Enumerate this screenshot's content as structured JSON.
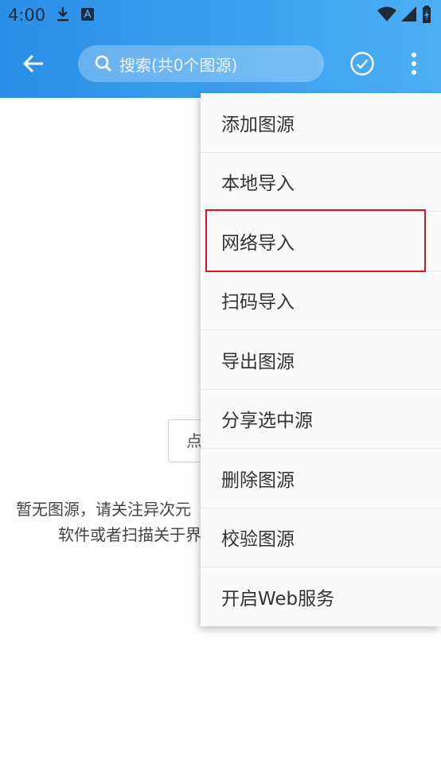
{
  "status": {
    "time": "4:00"
  },
  "search": {
    "placeholder": "搜索(共0个图源)"
  },
  "empty": {
    "button_label": "点",
    "text_line1": "暂无图源，请关注异次元",
    "text_line2": "软件或者扫描关于界"
  },
  "menu": {
    "items": [
      {
        "label": "添加图源"
      },
      {
        "label": "本地导入"
      },
      {
        "label": "网络导入"
      },
      {
        "label": "扫码导入"
      },
      {
        "label": "导出图源"
      },
      {
        "label": "分享选中源"
      },
      {
        "label": "删除图源"
      },
      {
        "label": "校验图源"
      },
      {
        "label": "开启Web服务"
      }
    ],
    "highlighted_index": 2
  },
  "colors": {
    "appbar": "#3a9ef0",
    "highlight": "#d9141c"
  }
}
